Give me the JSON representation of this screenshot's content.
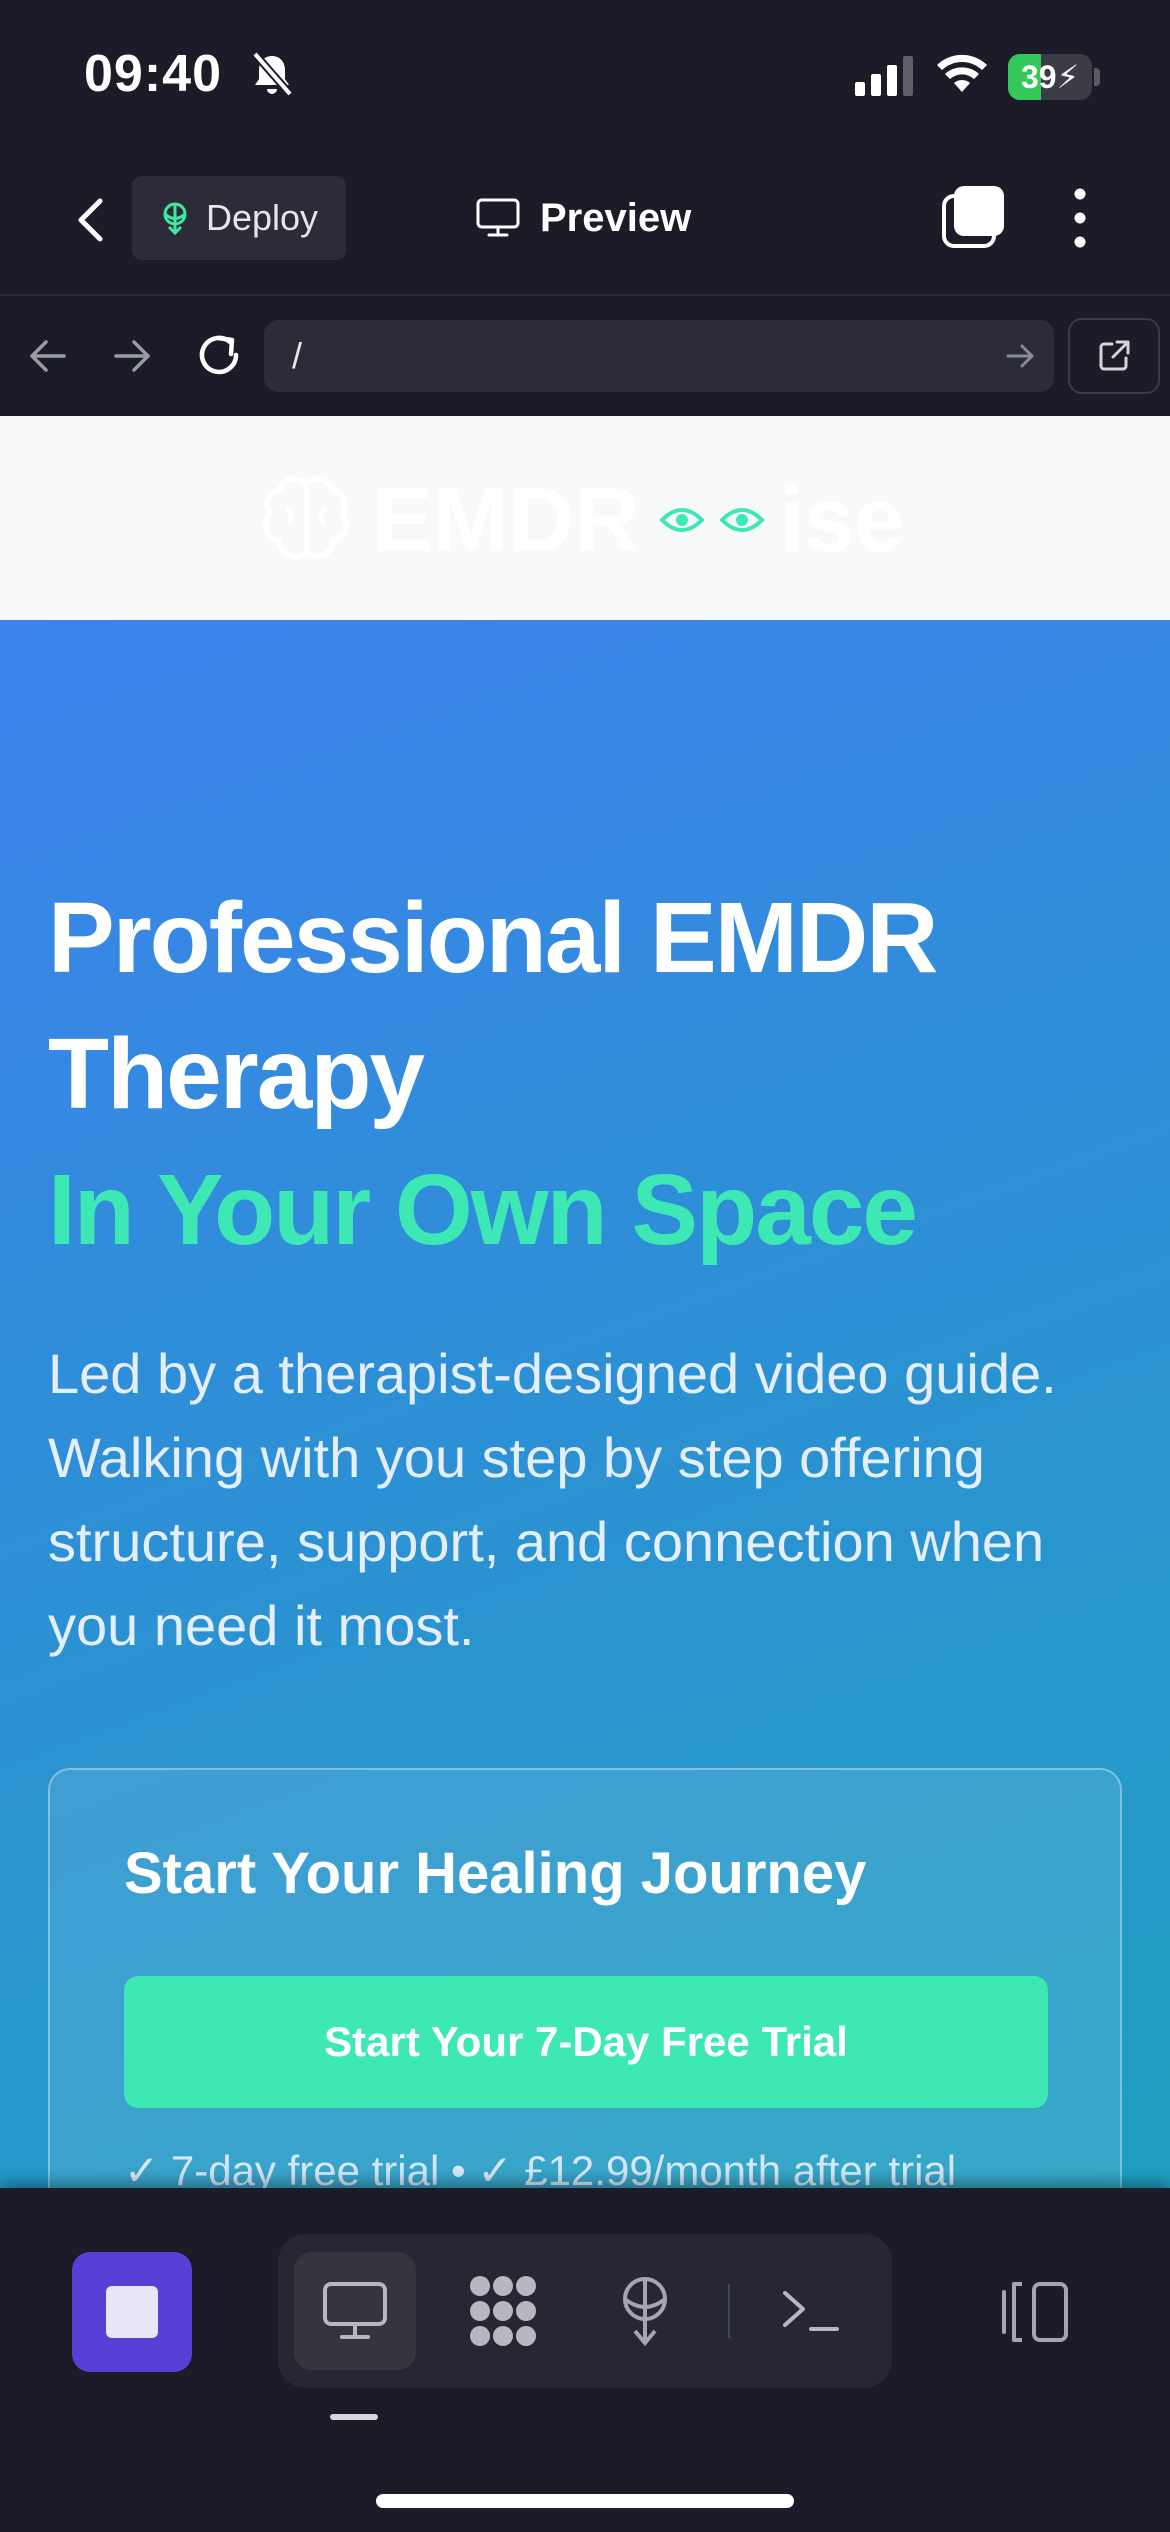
{
  "status_bar": {
    "time": "09:40",
    "battery_level": 39,
    "battery_text": "39",
    "battery_color": "#34c759"
  },
  "header": {
    "deploy_label": "Deploy",
    "title": "Preview"
  },
  "browser": {
    "url": "/"
  },
  "site": {
    "logo_left": "EMDR",
    "logo_right": "ise",
    "hero_title": "Professional EMDR Therapy",
    "hero_highlight": "In Your Own Space",
    "hero_description": "Led by a therapist-designed video guide. Walking with you step by step offering structure, support, and connection when you need it most.",
    "card_title": "Start Your Healing Journey",
    "cta_label": "Start Your 7-Day Free Trial",
    "card_note": "✓ 7-day free trial • ✓ £12.99/month after trial",
    "accent_color": "#3ee8b5"
  },
  "dock": {
    "modes": [
      {
        "icon": "desktop-icon",
        "active": true
      },
      {
        "icon": "apps-grid-icon",
        "active": false
      },
      {
        "icon": "deploy-icon",
        "active": false
      },
      {
        "icon": "terminal-icon",
        "active": false
      }
    ],
    "stop_color": "#5a3fd6"
  }
}
